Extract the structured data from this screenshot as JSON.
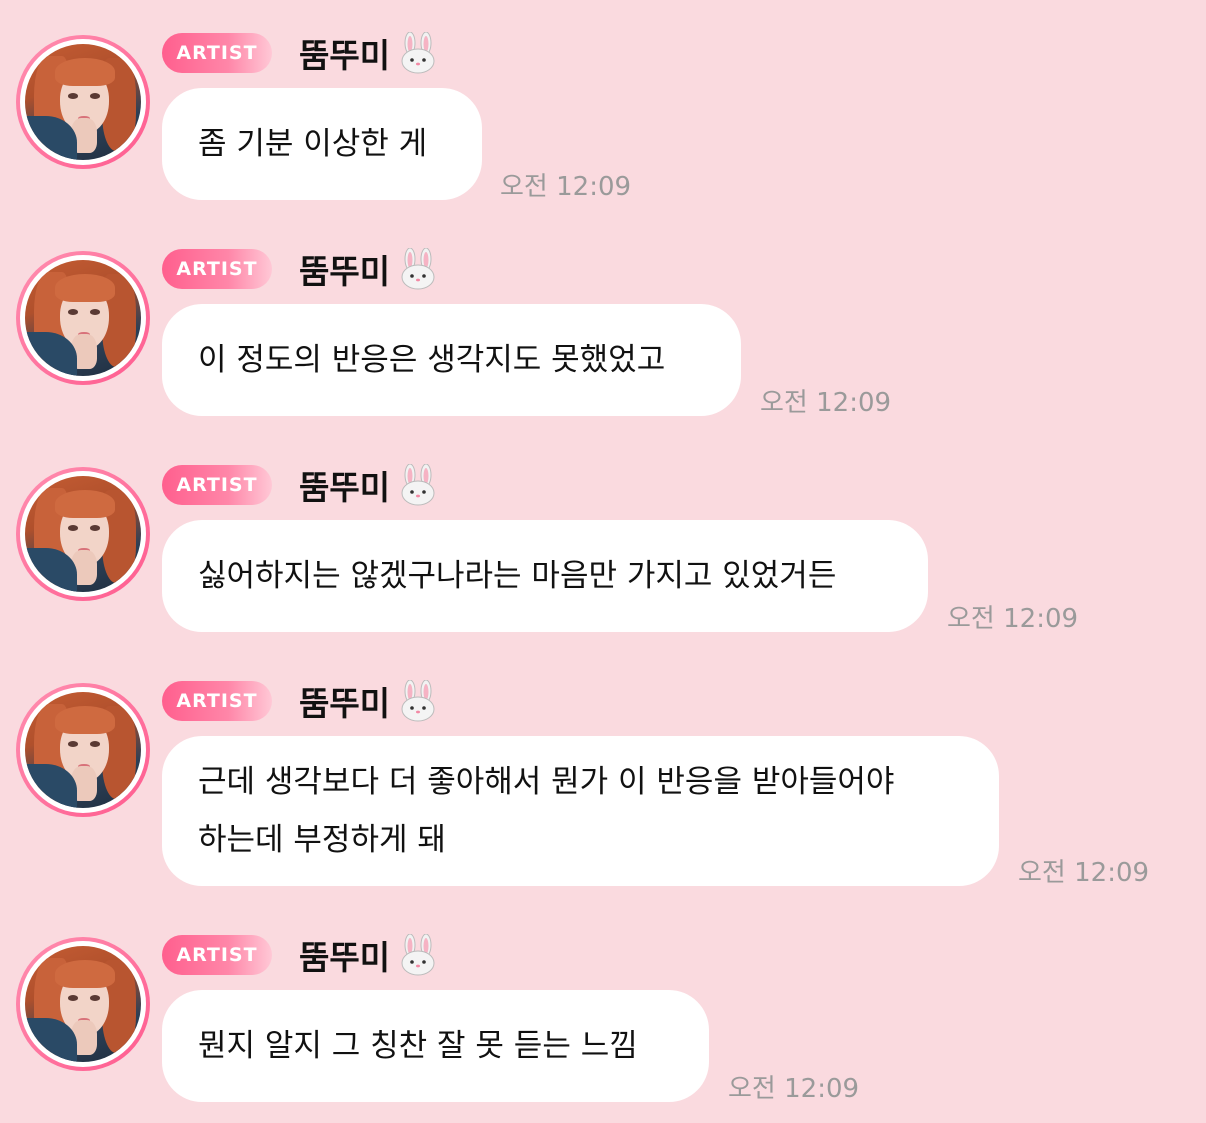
{
  "messages": [
    {
      "badge": "ARTIST",
      "name": "뚬뚜미",
      "emoji": "bunny-face-icon",
      "lines": [
        "좀 기분 이상한 게"
      ],
      "time": "오전 12:09"
    },
    {
      "badge": "ARTIST",
      "name": "뚬뚜미",
      "emoji": "bunny-face-icon",
      "lines": [
        "이 정도의 반응은 생각지도 못했었고"
      ],
      "time": "오전 12:09"
    },
    {
      "badge": "ARTIST",
      "name": "뚬뚜미",
      "emoji": "bunny-face-icon",
      "lines": [
        "싫어하지는 않겠구나라는 마음만 가지고 있었거든"
      ],
      "time": "오전 12:09"
    },
    {
      "badge": "ARTIST",
      "name": "뚬뚜미",
      "emoji": "bunny-face-icon",
      "lines": [
        "근데 생각보다 더 좋아해서 뭔가 이 반응을 받아들어야",
        "하는데 부정하게 돼"
      ],
      "time": "오전 12:09"
    },
    {
      "badge": "ARTIST",
      "name": "뚬뚜미",
      "emoji": "bunny-face-icon",
      "lines": [
        "뭔지 알지 그 칭찬 잘 못 듣는 느낌"
      ],
      "time": "오전 12:09"
    }
  ],
  "colors": {
    "background": "#fadadf",
    "badge_start": "#ff5f8e",
    "bubble": "#ffffff",
    "time": "#9a9a9a"
  }
}
